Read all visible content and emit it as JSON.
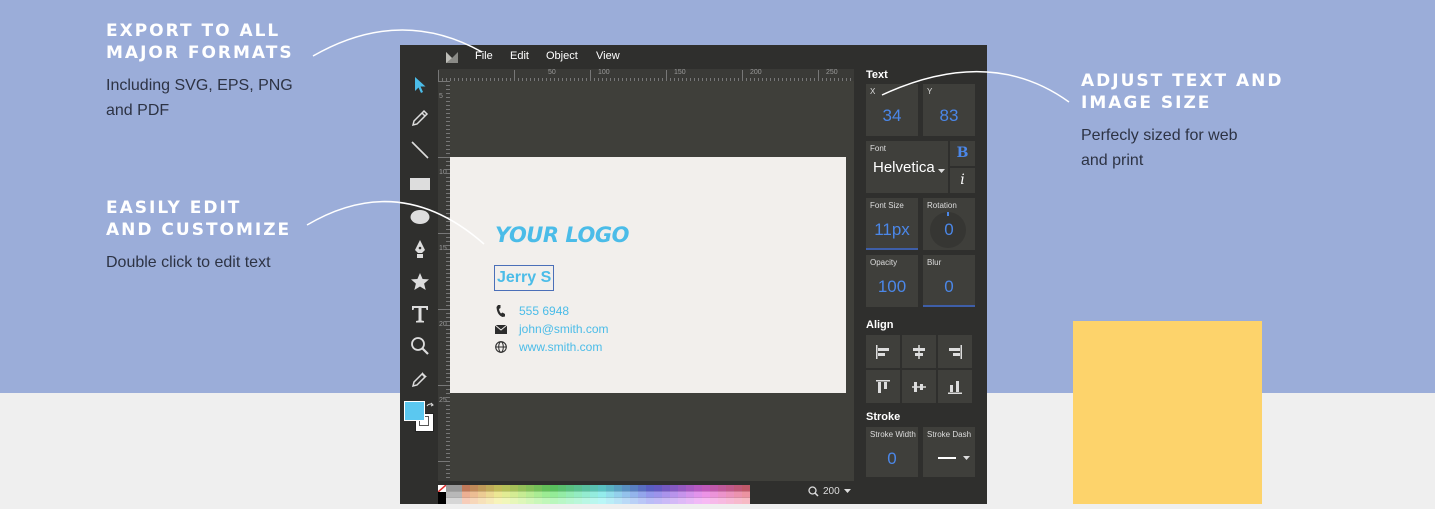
{
  "features": [
    {
      "title_line1": "EXPORT TO ALL",
      "title_line2": "MAJOR FORMATS",
      "desc_line1": "Including SVG, EPS, PNG",
      "desc_line2": "and PDF"
    },
    {
      "title_line1": "EASILY EDIT",
      "title_line2": "AND CUSTOMIZE",
      "desc_line1": "Double click to edit text",
      "desc_line2": ""
    },
    {
      "title_line1": "ADJUST TEXT AND",
      "title_line2": "IMAGE SIZE",
      "desc_line1": "Perfecly sized for web",
      "desc_line2": "and print"
    }
  ],
  "menu": [
    "File",
    "Edit",
    "Object",
    "View"
  ],
  "tools": [
    "select-tool",
    "pencil-tool",
    "line-tool",
    "rectangle-tool",
    "ellipse-tool",
    "pen-tool",
    "star-tool",
    "text-tool",
    "zoom-tool",
    "eyedropper-tool"
  ],
  "ruler": {
    "marks": [
      "50",
      "100",
      "150",
      "200",
      "250"
    ],
    "vmarks": [
      "5",
      "10",
      "15",
      "20",
      "25"
    ]
  },
  "card": {
    "logo": "YOUR LOGO",
    "name": "Jerry S",
    "phone": "555 6948",
    "email": "john@smith.com",
    "web": "www.smith.com"
  },
  "zoom": {
    "value": "200"
  },
  "panel": {
    "text_title": "Text",
    "x_label": "X",
    "x_value": "34",
    "y_label": "Y",
    "y_value": "83",
    "font_label": "Font",
    "font_value": "Helvetica",
    "bold_label": "B",
    "italic_label": "i",
    "font_size_label": "Font Size",
    "font_size_value": "11px",
    "rotation_label": "Rotation",
    "rotation_value": "0",
    "opacity_label": "Opacity",
    "opacity_value": "100",
    "blur_label": "Blur",
    "blur_value": "0",
    "align_title": "Align",
    "stroke_title": "Stroke",
    "stroke_width_label": "Stroke Width",
    "stroke_width_value": "0",
    "stroke_dash_label": "Stroke Dash"
  },
  "colors": {
    "background_blue": "#9badd9",
    "accent_yellow": "#fdd36b",
    "logo_blue": "#4bbce8",
    "value_blue": "#4b87e8",
    "fill_swatch": "#5bc8f0"
  }
}
